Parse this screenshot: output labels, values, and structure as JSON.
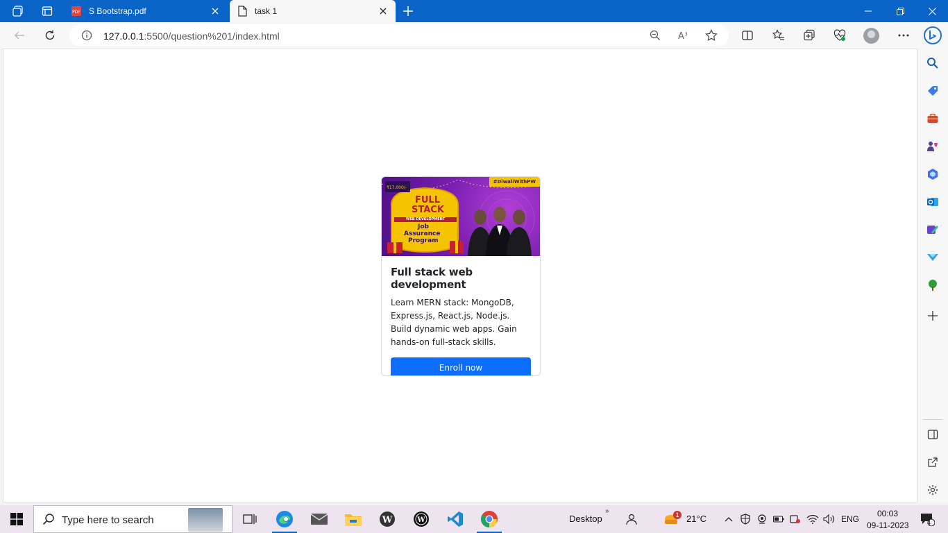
{
  "browser": {
    "tabs": [
      {
        "label": "S Bootstrap.pdf",
        "active": false
      },
      {
        "label": "task 1",
        "active": true
      }
    ],
    "address": {
      "host": "127.0.0.1",
      "path": ":5500/question%201/index.html"
    }
  },
  "card": {
    "image_alt": "Full Stack Web Development Job Assurance Program",
    "banner": {
      "hashtag": "#DiwaliWithPW",
      "price_tag": "₹17,000/-",
      "line1": "FULL",
      "line2": "STACK",
      "ribbon": "WEB DEVELOPMENT",
      "sub1": "Job",
      "sub2": "Assurance",
      "sub3": "Program"
    },
    "title": "Full stack web development",
    "text": "Learn MERN stack: MongoDB, Express.js, React.js, Node.js. Build dynamic web apps. Gain hands-on full-stack skills.",
    "button": "Enroll now"
  },
  "taskbar": {
    "search_placeholder": "Type here to search",
    "desktop_label": "Desktop",
    "weather": "21°C",
    "weather_badge": "1",
    "language": "ENG",
    "time": "00:03",
    "date": "09-11-2023",
    "notification_count": "4"
  },
  "colors": {
    "titlebar": "#0a64c8",
    "primary_button": "#0d6efd",
    "banner_purple": "#7a1fb0",
    "banner_gold": "#f5c400"
  }
}
